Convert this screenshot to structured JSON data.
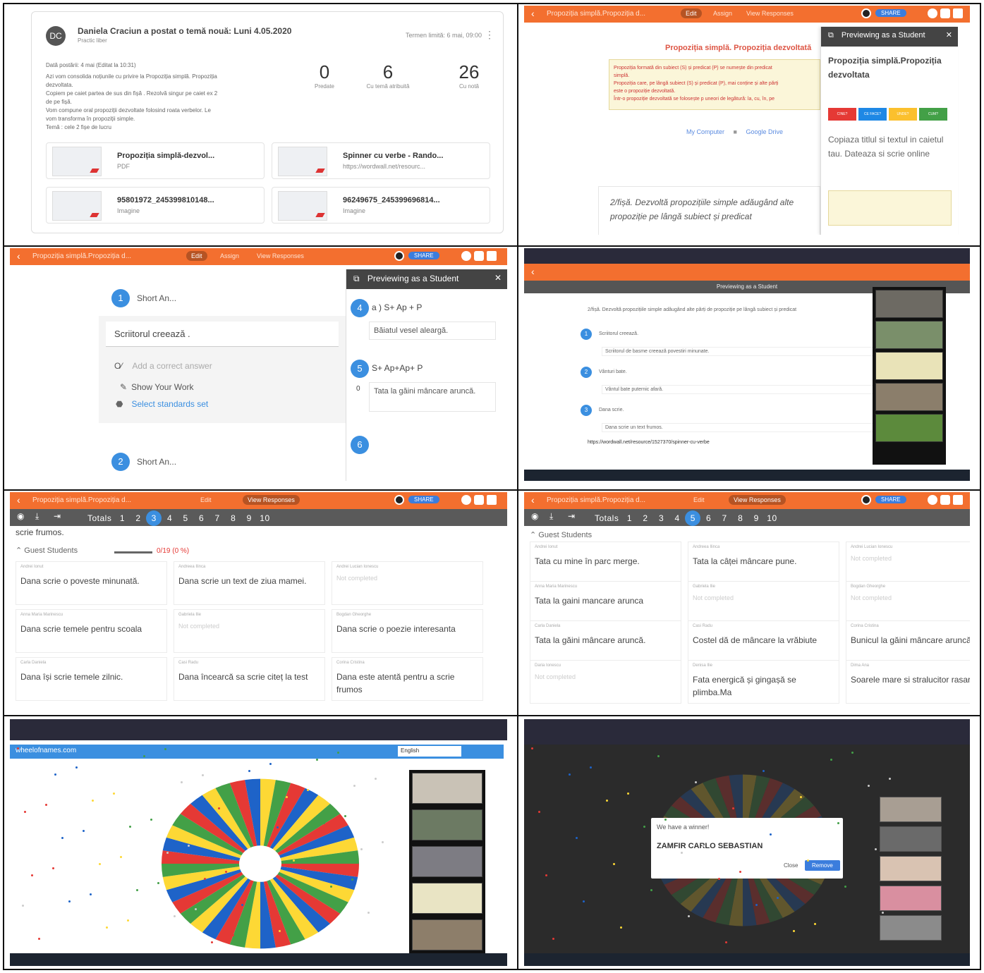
{
  "cell1": {
    "avatar": "DC",
    "title": "Daniela Craciun a postat o temă nouă: Luni 4.05.2020",
    "subtitle": "Practic liber",
    "due": "Termen limită: 6 mai, 09:00",
    "posted": "Dată postării: 4 mai (Editat la 10:31)",
    "body_lines": [
      "Azi vom consolida noțiunile cu privire la Propoziția simplă. Propoziția",
      "dezvoltata.",
      "Copiem pe caiet partea de sus din fișă . Rezolvă singur pe caiet ex 2",
      "de pe fișă.",
      "Vom compune oral propoziții dezvoltate folosind roata verbelor. Le",
      "vom transforma în propoziții simple.",
      "Temă : cele 2 fișe de lucru"
    ],
    "stats": [
      {
        "value": "0",
        "label": "Predate"
      },
      {
        "value": "6",
        "label": "Cu temă atribuită"
      },
      {
        "value": "26",
        "label": "Cu notă"
      }
    ],
    "attachments": [
      {
        "name": "Propoziția simplă-dezvol...",
        "type": "PDF"
      },
      {
        "name": "Spinner cu verbe - Rando...",
        "type": "https://wordwall.net/resourc..."
      },
      {
        "name": "95801972_245399810148...",
        "type": "Imagine"
      },
      {
        "name": "96249675_245399696814...",
        "type": "Imagine"
      }
    ]
  },
  "topbar": {
    "title": "Propoziția simplă.Propoziția d...",
    "edit": "Edit",
    "assign": "Assign",
    "view_responses": "View Responses",
    "share": "SHARE"
  },
  "cell2": {
    "heading": "Propoziția simplă. Propoziția dezvoltată",
    "note_lines": [
      "Propoziția formată din subiect (S) și predicat (P) se numește din predicat",
      "simplă.",
      "Propoziția care, pe lângă subiect (S) și predicat (P), mai conține și alte părți",
      "este o propoziție dezvoltată.",
      "Într-o propoziție dezvoltată se folosește p uneori de legătură: la, cu, în, pe"
    ],
    "link1": "My Computer",
    "link2": "Google Drive",
    "question": "2/fișă. Dezvoltă propozițiile simple adăugând alte propoziție pe lângă subiect și predicat",
    "panel_header": "Previewing as a Student",
    "panel_title": "Propoziția simplă.Propoziția dezvoltata",
    "pieces": [
      "CINE?",
      "CE FACE?",
      "UNDE?",
      "CUM?"
    ],
    "panel_text": "Copiaza titlul si textul in caietul tau. Dateaza si scrie online"
  },
  "cell3": {
    "q1_num": "1",
    "q1_label": "Short An...",
    "q1_answer": "Scriitorul creează .",
    "add_answer": "Add a correct answer",
    "show_work": "Show Your Work",
    "standards": "Select standards set",
    "q2_num": "2",
    "q2_label": "Short An...",
    "panel_header": "Previewing as a Student",
    "p4_num": "4",
    "p4_label": "a ) S+ Ap + P",
    "p4_answer": "Băiatul vesel aleargă.",
    "p5_num": "5",
    "p5_label": "S+ Ap+Ap+ P",
    "p5_answer": "Tata la găini mâncare aruncă.",
    "p6_num": "6",
    "zero": "0"
  },
  "cell4": {
    "preview": "Previewing as a Student",
    "instruction": "2/fișă. Dezvoltă propozițiile simple adăugând alte părți de propoziție pe lângă subiect și predicat",
    "items": [
      {
        "num": "1",
        "q": "Scriitorul creează.",
        "a": "Scriitorul de basme creează povestiri minunate."
      },
      {
        "num": "2",
        "q": "Vânturi bate.",
        "a": "Vântul bate puternic afară."
      },
      {
        "num": "3",
        "q": "Dana scrie.",
        "a": "Dana scrie un text frumos."
      }
    ],
    "link": "https://wordwall.net/resource/1527370/spinner-cu-verbe"
  },
  "cell5": {
    "totals": "Totals",
    "numbers": [
      "1",
      "2",
      "3",
      "4",
      "5",
      "6",
      "7",
      "8",
      "9",
      "10"
    ],
    "active": "3",
    "scrap": "scrie frumos.",
    "guest": "Guest Students",
    "progress": "0/19 (0 %)",
    "answers": [
      {
        "name": "Andrei Ionut",
        "text": "Dana scrie o poveste minunată."
      },
      {
        "name": "Andreea Ilinca",
        "text": "Dana scrie un text de ziua mamei."
      },
      {
        "name": "Andrei Lucian Ionescu",
        "text": ""
      },
      {
        "name": "Anna Maria Marinescu",
        "text": "Dana scrie temele pentru scoala"
      },
      {
        "name": "Gabriela Ilie",
        "text": ""
      },
      {
        "name": "Bogdan Gheorghe",
        "text": "Dana scrie o poezie interesanta"
      },
      {
        "name": "Carla Daniela",
        "text": "Dana își scrie temele zilnic."
      },
      {
        "name": "Casi Radu",
        "text": "Dana încearcă sa scrie citeț la test"
      },
      {
        "name": "Corina Cristina",
        "text": "Dana este atentă pentru a scrie frumos"
      }
    ],
    "no_answer": "Not completed"
  },
  "cell6": {
    "totals": "Totals",
    "numbers": [
      "1",
      "2",
      "3",
      "4",
      "5",
      "6",
      "7",
      "8",
      "9",
      "10"
    ],
    "active": "5",
    "guest": "Guest Students",
    "answers": [
      {
        "name": "Andrei Ionut",
        "text": "Tata cu mine în parc merge."
      },
      {
        "name": "Andreea Ilinca",
        "text": "Tata la câței mâncare pune."
      },
      {
        "name": "Andrei Lucian Ionescu",
        "text": ""
      },
      {
        "name": "Anna Maria Marinescu",
        "text": "Tata la gaini mancare arunca"
      },
      {
        "name": "Gabriela Ilie",
        "text": ""
      },
      {
        "name": "Bogdan Gheorghe",
        "text": ""
      },
      {
        "name": "Carla Daniela",
        "text": "Tata la găini mâncare aruncă."
      },
      {
        "name": "Casi Radu",
        "text": "Costel dă de mâncare la vrăbiute"
      },
      {
        "name": "Corina Cristina",
        "text": "Bunicul la găini mâncare aruncă"
      },
      {
        "name": "Daria Ionescu",
        "text": ""
      },
      {
        "name": "Denisa Ilie",
        "text": "Fata energică și gingașă se plimba.Ma"
      },
      {
        "name": "Dima Ana",
        "text": "Soarele mare si stralucitor rasare"
      }
    ],
    "no_answer": "Not completed"
  },
  "cell7": {
    "site": "wheelofnames.com",
    "language": "English"
  },
  "cell8": {
    "modal_header": "We have a winner!",
    "winner": "ZAMFIR CARLO SEBASTIAN",
    "close": "Close",
    "remove": "Remove"
  },
  "colors": {
    "orange": "#f36f2f",
    "blue": "#3b8fe0",
    "red": "#e53935",
    "green": "#43a047",
    "yellow": "#fdd835",
    "wheel_blue": "#1e63c8"
  }
}
